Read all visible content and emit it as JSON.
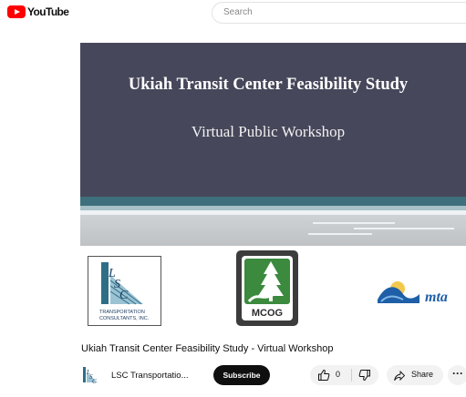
{
  "header": {
    "brand": "YouTube",
    "search_placeholder": "Search"
  },
  "video": {
    "slide_title": "Ukiah Transit Center Feasibility Study",
    "slide_subtitle": "Virtual Public Workshop",
    "logos": {
      "lsc_caption_line1": "TRANSPORTATION",
      "lsc_caption_line2": "CONSULTANTS, INC.",
      "mcog_text": "MCOG",
      "mta_text": "mta"
    }
  },
  "details": {
    "title": "Ukiah Transit Center Feasibility Study - Virtual Workshop",
    "channel_name": "LSC Transportatio...",
    "subscribe_label": "Subscribe",
    "like_count": "0",
    "share_label": "Share",
    "more_label": "···"
  },
  "colors": {
    "brand_red": "#ff0000",
    "slide_background": "#46475a",
    "slide_band": "#3e6f7c",
    "subscribe_bg": "#0f0f0f"
  },
  "icons": [
    "youtube-play-icon",
    "thumbs-up-icon",
    "thumbs-down-icon",
    "share-icon",
    "more-icon"
  ]
}
